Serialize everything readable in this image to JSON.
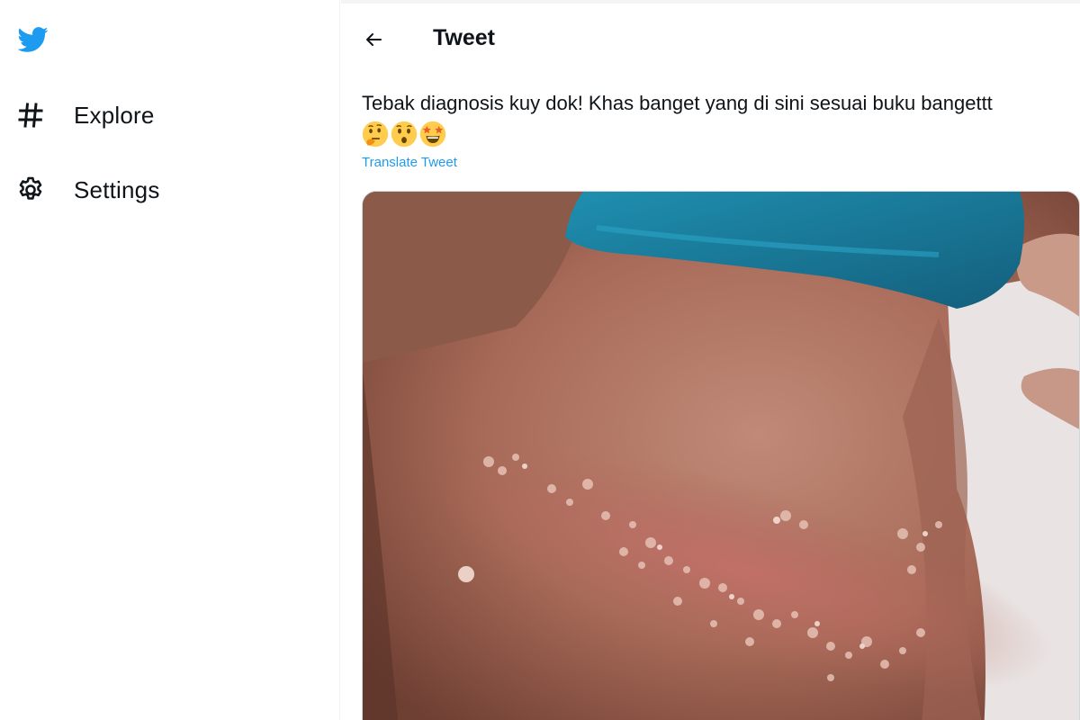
{
  "sidebar": {
    "logo_icon": "twitter-bird-icon",
    "items": [
      {
        "label": "Explore",
        "icon": "hashtag-icon"
      },
      {
        "label": "Settings",
        "icon": "gear-icon"
      }
    ]
  },
  "header": {
    "back_icon": "arrow-left-icon",
    "title": "Tweet"
  },
  "tweet": {
    "text": "Tebak diagnosis kuy dok! Khas banget yang di sini sesuai buku bangettt",
    "emojis": [
      "thinking-face-emoji",
      "hushed-face-emoji",
      "star-struck-emoji"
    ],
    "translate_label": "Translate Tweet",
    "media": "photo-skin-rash"
  },
  "colors": {
    "brand_blue": "#1d9bf0",
    "text_primary": "#0f1419",
    "border": "#eff3f4"
  }
}
